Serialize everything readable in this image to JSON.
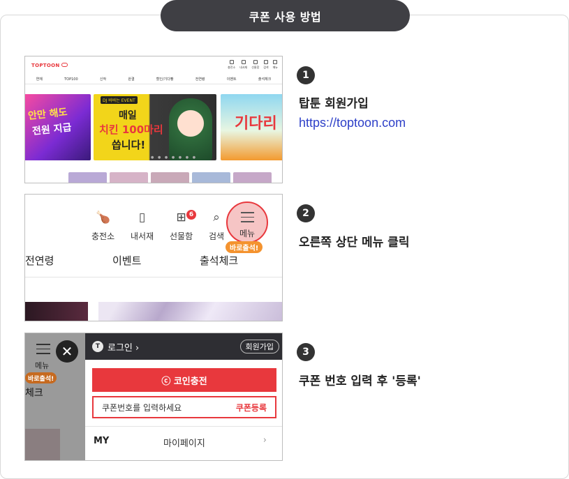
{
  "title": "쿠폰 사용 방법",
  "steps": [
    {
      "number": "1",
      "text": "탑툰 회원가입",
      "link": "https://toptoon.com"
    },
    {
      "number": "2",
      "text": "오른쪽 상단 메뉴 클릭"
    },
    {
      "number": "3",
      "text": "쿠폰 번호 입력 후 '등록'"
    }
  ],
  "shot1": {
    "logo": "TOPTOON",
    "icons": [
      {
        "label": "충전소",
        "icon": "charge-icon"
      },
      {
        "label": "내서재",
        "icon": "library-icon"
      },
      {
        "label": "선물함",
        "icon": "gift-icon"
      },
      {
        "label": "검색",
        "icon": "search-icon"
      },
      {
        "label": "메뉴",
        "icon": "menu-icon"
      }
    ],
    "nav": [
      "연재",
      "TOP100",
      "신작",
      "완결",
      "할인/기다빵",
      "전연령",
      "이벤트",
      "출석체크"
    ],
    "banner1_line1": "안만 해도",
    "banner1_line2": "전원 지급",
    "banner2_tag": "DJ 바바는 EVENT",
    "banner2_line1": "매일",
    "banner2_line2": "치킨 100마리",
    "banner2_line3": "씁니다!",
    "banner3_text": "기다리",
    "dots": "● ● ● ● ● ● ●"
  },
  "shot2": {
    "icons": [
      {
        "label": "충전소",
        "icon": "charge-icon"
      },
      {
        "label": "내서재",
        "icon": "library-icon"
      },
      {
        "label": "선물함",
        "icon": "gift-icon"
      },
      {
        "label": "검색",
        "icon": "search-icon"
      }
    ],
    "gift_badge": "6",
    "menu_label": "메뉴",
    "bubble": "바로출석!",
    "nav": [
      "전연령",
      "이벤트",
      "출석체크"
    ]
  },
  "shot3": {
    "menu_label": "메뉴",
    "bubble": "바로출석!",
    "partial": "체크",
    "close": "✕",
    "logo": "T",
    "login": "로그인 ›",
    "join": "회원가입",
    "charge": "ⓒ 코인충전",
    "coupon_placeholder": "쿠폰번호를 입력하세요",
    "coupon_register": "쿠폰등록",
    "my": "MY",
    "mypage": "마이페이지",
    "arrow": "›"
  }
}
